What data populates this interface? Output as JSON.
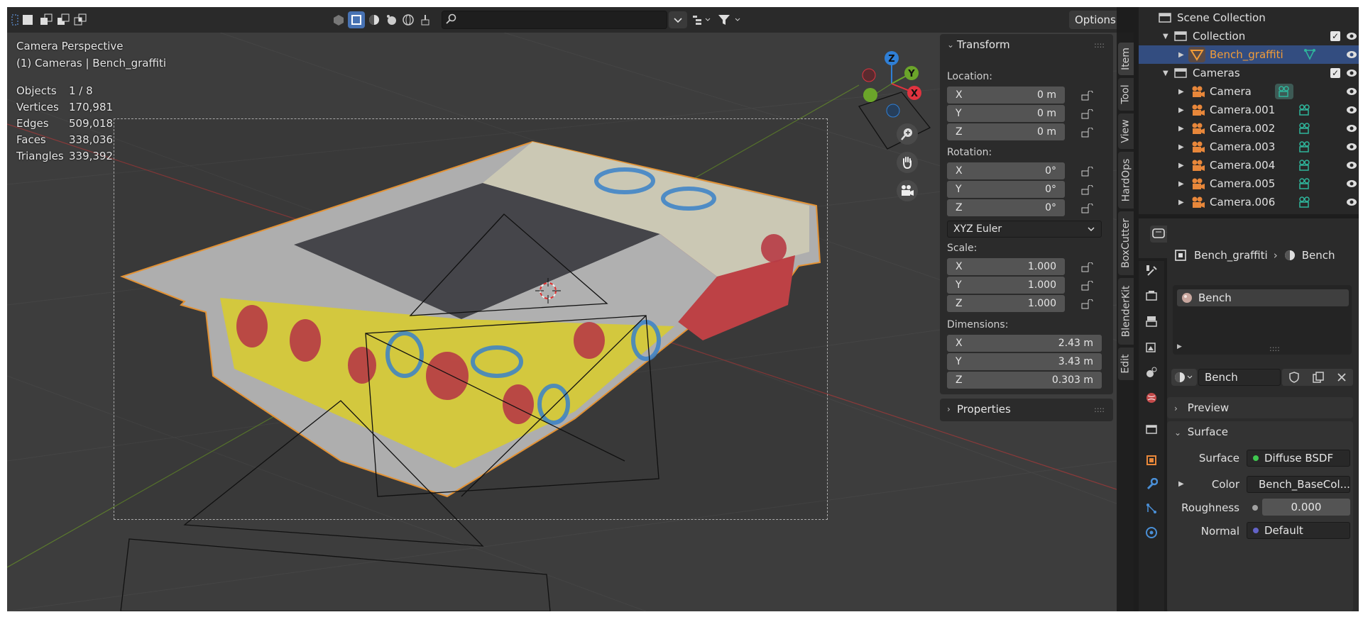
{
  "viewport": {
    "header": {
      "search_placeholder": "",
      "options_label": "Options"
    },
    "view_name": "Camera Perspective",
    "view_context": "(1) Cameras | Bench_graffiti",
    "stats": [
      {
        "label": "Objects",
        "value": "1 / 8"
      },
      {
        "label": "Vertices",
        "value": "170,981"
      },
      {
        "label": "Edges",
        "value": "509,018"
      },
      {
        "label": "Faces",
        "value": "338,036"
      },
      {
        "label": "Triangles",
        "value": "339,392"
      }
    ],
    "gizmo": {
      "x": "X",
      "y": "Y",
      "z": "Z"
    }
  },
  "npanel": {
    "transform": {
      "title": "Transform",
      "location_label": "Location:",
      "location": [
        {
          "axis": "X",
          "value": "0 m"
        },
        {
          "axis": "Y",
          "value": "0 m"
        },
        {
          "axis": "Z",
          "value": "0 m"
        }
      ],
      "rotation_label": "Rotation:",
      "rotation": [
        {
          "axis": "X",
          "value": "0°"
        },
        {
          "axis": "Y",
          "value": "0°"
        },
        {
          "axis": "Z",
          "value": "0°"
        }
      ],
      "rotation_mode": "XYZ Euler",
      "scale_label": "Scale:",
      "scale": [
        {
          "axis": "X",
          "value": "1.000"
        },
        {
          "axis": "Y",
          "value": "1.000"
        },
        {
          "axis": "Z",
          "value": "1.000"
        }
      ],
      "dimensions_label": "Dimensions:",
      "dimensions": [
        {
          "axis": "X",
          "value": "2.43 m"
        },
        {
          "axis": "Y",
          "value": "3.43 m"
        },
        {
          "axis": "Z",
          "value": "0.303 m"
        }
      ]
    },
    "properties_title": "Properties",
    "tabs": [
      "Item",
      "Tool",
      "View",
      "HardOps",
      "BoxCutter",
      "BlenderKit",
      "Edit"
    ]
  },
  "outliner": {
    "rows": [
      {
        "label": "Scene Collection"
      },
      {
        "label": "Collection"
      },
      {
        "label": "Bench_graffiti"
      },
      {
        "label": "Cameras"
      },
      {
        "label": "Camera"
      },
      {
        "label": "Camera.001"
      },
      {
        "label": "Camera.002"
      },
      {
        "label": "Camera.003"
      },
      {
        "label": "Camera.004"
      },
      {
        "label": "Camera.005"
      },
      {
        "label": "Camera.006"
      }
    ]
  },
  "properties": {
    "breadcrumb_object": "Bench_graffiti",
    "breadcrumb_material": "Bench",
    "material_slot": "Bench",
    "material_name": "Bench",
    "preview_label": "Preview",
    "surface_panel_label": "Surface",
    "surface_label": "Surface",
    "surface_value": "Diffuse BSDF",
    "color_label": "Color",
    "color_value": "Bench_BaseCol...",
    "roughness_label": "Roughness",
    "roughness_value": "0.000",
    "normal_label": "Normal",
    "normal_value": "Default"
  },
  "colors": {
    "selected_row": "#334d80",
    "object_orange": "#f29c38",
    "camera_green": "#2fb59b",
    "axis_x": "#e0333f",
    "axis_y": "#6ba52a",
    "axis_z": "#2f7fd6"
  }
}
